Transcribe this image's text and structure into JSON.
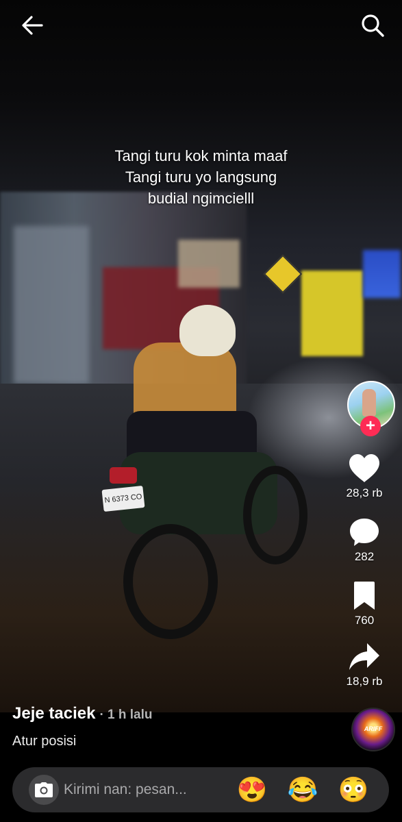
{
  "header": {
    "back_icon": "arrow-left-icon",
    "search_icon": "search-icon"
  },
  "video": {
    "caption_lines": [
      "Tangi turu kok minta maaf",
      "Tangi turu yo langsung",
      "budial ngimcielll"
    ],
    "plate_text": "N 6373 CO"
  },
  "actions": {
    "likes": "28,3 rb",
    "comments": "282",
    "saves": "760",
    "shares": "18,9 rb",
    "follow_symbol": "+"
  },
  "post": {
    "username": "Jeje taciek",
    "time": "· 1 h lalu",
    "description": "Atur posisi",
    "music_label": "ARIFF"
  },
  "comment_bar": {
    "placeholder": "Kirimi nan: pesan...",
    "emojis": [
      "😍",
      "😂",
      "😳"
    ]
  },
  "colors": {
    "accent": "#fe2c55",
    "background": "#000000"
  }
}
